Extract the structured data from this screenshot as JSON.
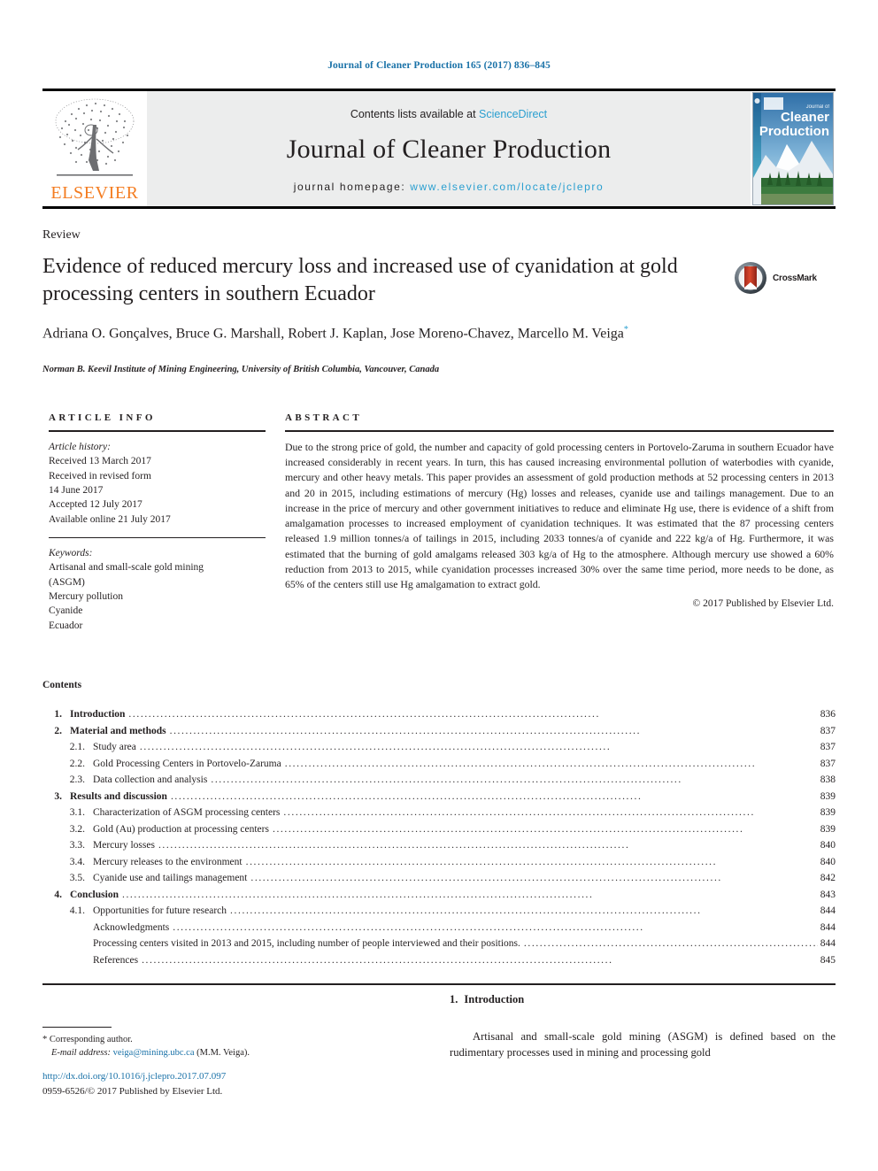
{
  "running_head": "Journal of Cleaner Production 165 (2017) 836–845",
  "masthead": {
    "publisher": "ELSEVIER",
    "contents_prefix": "Contents lists available at ",
    "contents_link": "ScienceDirect",
    "journal_title": "Journal of Cleaner Production",
    "homepage_prefix": "journal homepage: ",
    "homepage_url": "www.elsevier.com/locate/jclepro",
    "cover_line1": "Journal of",
    "cover_line2": "Cleaner",
    "cover_line3": "Production",
    "link_color": "#2a9fd0",
    "band_color": "#eceded",
    "elsevier_color": "#f47c20"
  },
  "article": {
    "type_label": "Review",
    "title": "Evidence of reduced mercury loss and increased use of cyanidation at gold processing centers in southern Ecuador",
    "authors": "Adriana O. Gonçalves, Bruce G. Marshall, Robert J. Kaplan, Jose Moreno-Chavez, Marcello M. Veiga",
    "author_marker": "*",
    "affiliation": "Norman B. Keevil Institute of Mining Engineering, University of British Columbia, Vancouver, Canada",
    "crossmark_label": "CrossMark"
  },
  "article_info": {
    "heading": "ARTICLE INFO",
    "history_label": "Article history:",
    "history": [
      "Received 13 March 2017",
      "Received in revised form",
      "14 June 2017",
      "Accepted 12 July 2017",
      "Available online 21 July 2017"
    ],
    "keywords_label": "Keywords:",
    "keywords": [
      "Artisanal and small-scale gold mining",
      "(ASGM)",
      "Mercury pollution",
      "Cyanide",
      "Ecuador"
    ]
  },
  "abstract": {
    "heading": "ABSTRACT",
    "text": "Due to the strong price of gold, the number and capacity of gold processing centers in Portovelo-Zaruma in southern Ecuador have increased considerably in recent years. In turn, this has caused increasing environmental pollution of waterbodies with cyanide, mercury and other heavy metals. This paper provides an assessment of gold production methods at 52 processing centers in 2013 and 20 in 2015, including estimations of mercury (Hg) losses and releases, cyanide use and tailings management. Due to an increase in the price of mercury and other government initiatives to reduce and eliminate Hg use, there is evidence of a shift from amalgamation processes to increased employment of cyanidation techniques. It was estimated that the 87 processing centers released 1.9 million tonnes/a of tailings in 2015, including 2033 tonnes/a of cyanide and 222 kg/a of Hg. Furthermore, it was estimated that the burning of gold amalgams released 303 kg/a of Hg to the atmosphere. Although mercury use showed a 60% reduction from 2013 to 2015, while cyanidation processes increased 30% over the same time period, more needs to be done, as 65% of the centers still use Hg amalgamation to extract gold.",
    "copyright": "© 2017 Published by Elsevier Ltd."
  },
  "contents": {
    "heading": "Contents",
    "items": [
      {
        "level": 1,
        "num": "1.",
        "label": "Introduction",
        "page": "836"
      },
      {
        "level": 1,
        "num": "2.",
        "label": "Material and methods",
        "page": "837"
      },
      {
        "level": 2,
        "num": "2.1.",
        "label": "Study area",
        "page": "837"
      },
      {
        "level": 2,
        "num": "2.2.",
        "label": "Gold Processing Centers in Portovelo-Zaruma",
        "page": "837"
      },
      {
        "level": 2,
        "num": "2.3.",
        "label": "Data collection and analysis",
        "page": "838"
      },
      {
        "level": 1,
        "num": "3.",
        "label": "Results and discussion",
        "page": "839"
      },
      {
        "level": 2,
        "num": "3.1.",
        "label": "Characterization of ASGM processing centers",
        "page": "839"
      },
      {
        "level": 2,
        "num": "3.2.",
        "label": "Gold (Au) production at processing centers",
        "page": "839"
      },
      {
        "level": 2,
        "num": "3.3.",
        "label": "Mercury losses",
        "page": "840"
      },
      {
        "level": 2,
        "num": "3.4.",
        "label": "Mercury releases to the environment",
        "page": "840"
      },
      {
        "level": 2,
        "num": "3.5.",
        "label": "Cyanide use and tailings management",
        "page": "842"
      },
      {
        "level": 1,
        "num": "4.",
        "label": "Conclusion",
        "page": "843"
      },
      {
        "level": 2,
        "num": "4.1.",
        "label": "Opportunities for future research",
        "page": "844"
      },
      {
        "level": 0,
        "num": "",
        "label": "Acknowledgments",
        "page": "844"
      },
      {
        "level": 0,
        "num": "",
        "label": "Processing centers visited in 2013 and 2015, including number of people interviewed and their positions.",
        "page": "844"
      },
      {
        "level": 0,
        "num": "",
        "label": "References",
        "page": "845"
      }
    ]
  },
  "footer": {
    "corresponding_marker": "*",
    "corresponding_label": "Corresponding author.",
    "email_label": "E-mail address:",
    "email": "veiga@mining.ubc.ca",
    "email_suffix": "(M.M. Veiga).",
    "doi": "http://dx.doi.org/10.1016/j.jclepro.2017.07.097",
    "issn_line": "0959-6526/© 2017 Published by Elsevier Ltd."
  },
  "introduction": {
    "number": "1.",
    "heading": "Introduction",
    "paragraph": "Artisanal and small-scale gold mining (ASGM) is defined based on the rudimentary processes used in mining and processing gold"
  }
}
